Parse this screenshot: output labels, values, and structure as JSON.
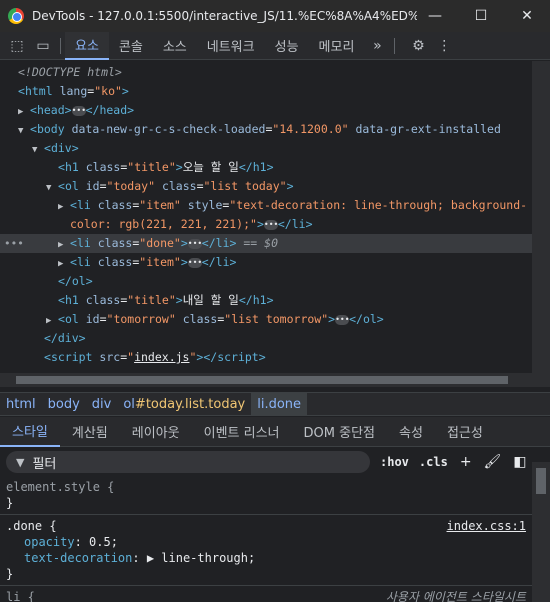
{
  "window": {
    "title": "DevTools - 127.0.0.1:5500/interactive_JS/11.%EC%8A%A4%ED%83%8...",
    "minimize": "—",
    "maximize": "☐",
    "close": "✕"
  },
  "toolbar": {
    "tabs": [
      "요소",
      "콘솔",
      "소스",
      "네트워크",
      "성능",
      "메모리"
    ],
    "more": "»",
    "settings": "⚙",
    "menu": "⋮"
  },
  "dom": {
    "doctype": "<!DOCTYPE html>",
    "html_open": "html",
    "html_lang": "lang",
    "html_lang_val": "\"ko\"",
    "head": "head",
    "body_tag": "body",
    "body_attr1": "data-new-gr-c-s-check-loaded",
    "body_attr1_val": "\"14.1200.0\"",
    "body_attr2": "data-gr-ext-installed",
    "div": "div",
    "h1": "h1",
    "class_attr": "class",
    "title_val": "\"title\"",
    "h1_text_today": "오늘 할 일",
    "ol": "ol",
    "id_attr": "id",
    "today_id": "\"today\"",
    "list_today": "\"list today\"",
    "li": "li",
    "item_val": "\"item\"",
    "style_attr": "style",
    "style_val_1": "\"text-decoration: line-through; background-",
    "style_val_2": "color: rgb(221, 221, 221);\"",
    "done_val": "\"done\"",
    "selected_marker": "== $0",
    "h1_text_tomorrow": "내일 할 일",
    "tomorrow_id": "\"tomorrow\"",
    "list_tomorrow": "\"list tomorrow\"",
    "script": "script",
    "src_attr": "src",
    "script_src": "index.js"
  },
  "breadcrumb": {
    "items": [
      "html",
      "body",
      "div"
    ],
    "ol_prefix": "ol",
    "ol_highlight": "#today.list.today",
    "last": "li.done"
  },
  "styles_tabs": [
    "스타일",
    "계산됨",
    "레이아웃",
    "이벤트 리스너",
    "DOM 중단점",
    "속성",
    "접근성"
  ],
  "filter": {
    "placeholder": "필터",
    "hov": ":hov",
    "cls": ".cls",
    "add": "+",
    "paint": "🖌",
    "toggle": "◧"
  },
  "styles": {
    "element_style": "element.style {",
    "close_brace": "}",
    "done_selector": ".done {",
    "done_source": "index.css:1",
    "opacity_prop": "opacity",
    "opacity_val": "0.5;",
    "textdec_prop": "text-decoration",
    "textdec_val": "line-through;",
    "li_selector": "li {",
    "ua_label": "사용자 에이전트 스타일시트"
  }
}
